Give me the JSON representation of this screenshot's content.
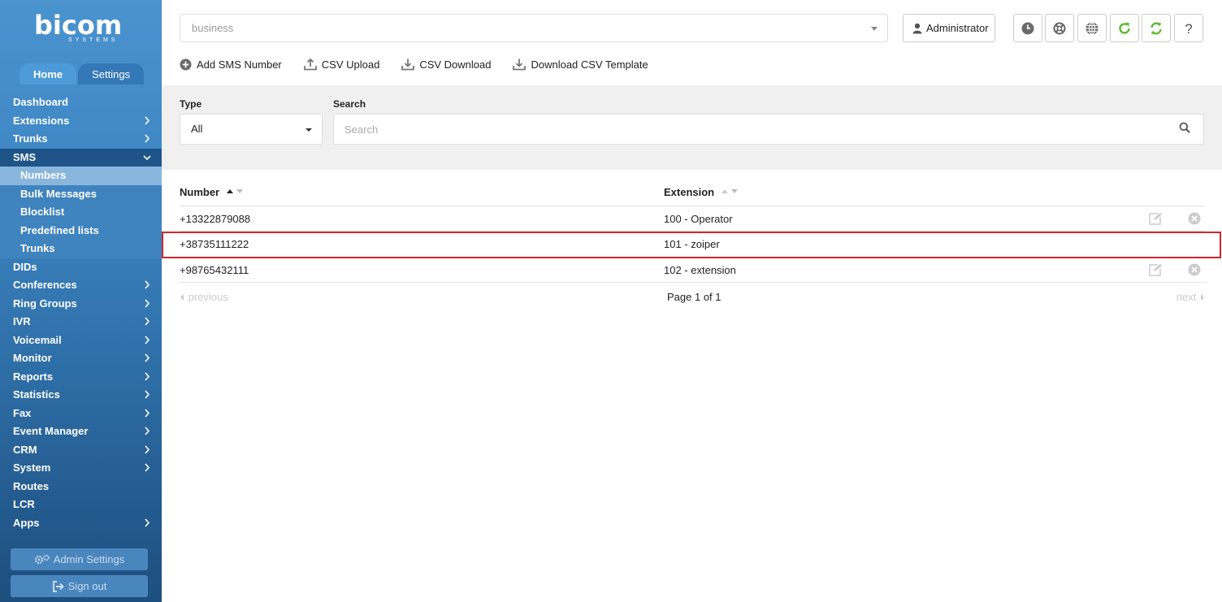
{
  "logo": {
    "word": "bicom",
    "sub": "SYSTEMS"
  },
  "tabs": [
    {
      "label": "Home"
    },
    {
      "label": "Settings"
    }
  ],
  "nav": {
    "dashboard": "Dashboard",
    "extensions": "Extensions",
    "trunks": "Trunks",
    "sms": "SMS",
    "sms_sub": [
      "Numbers",
      "Bulk Messages",
      "Blocklist",
      "Predefined lists",
      "Trunks"
    ],
    "dids": "DIDs",
    "conferences": "Conferences",
    "ring_groups": "Ring Groups",
    "ivr": "IVR",
    "voicemail": "Voicemail",
    "monitor": "Monitor",
    "reports": "Reports",
    "statistics": "Statistics",
    "fax": "Fax",
    "event_manager": "Event Manager",
    "crm": "CRM",
    "system": "System",
    "routes": "Routes",
    "lcr": "LCR",
    "apps": "Apps"
  },
  "sidebar_buttons": {
    "admin_settings": "Admin Settings",
    "sign_out": "Sign out"
  },
  "topbar": {
    "business_value": "business",
    "user": "Administrator"
  },
  "toolbar": {
    "add": "Add SMS Number",
    "upload": "CSV Upload",
    "download": "CSV Download",
    "template": "Download CSV Template"
  },
  "filters": {
    "type_label": "Type",
    "type_value": "All",
    "search_label": "Search",
    "search_placeholder": "Search"
  },
  "table": {
    "columns": [
      "Number",
      "Extension"
    ],
    "rows": [
      {
        "number": "+13322879088",
        "extension": "100 - Operator"
      },
      {
        "number": "+38735111222",
        "extension": "101 - zoiper"
      },
      {
        "number": "+98765432111",
        "extension": "102 - extension"
      }
    ]
  },
  "pager": {
    "previous": "previous",
    "info": "Page 1 of 1",
    "next": "next"
  },
  "colors": {
    "highlight": "#d2262b",
    "refresh_green": "#5cb82e",
    "sidebar_blue": "#3d86c4"
  }
}
